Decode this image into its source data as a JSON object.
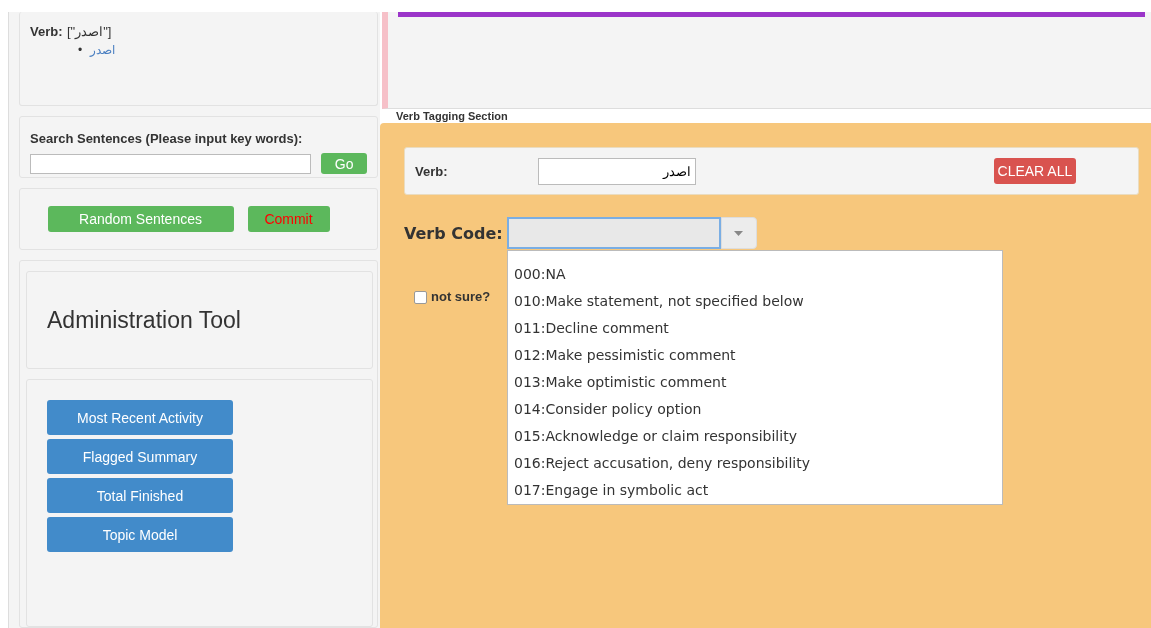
{
  "verb_panel": {
    "label": "Verb:",
    "value": "[\"اصدر\"]",
    "items": [
      {
        "bullet": "•",
        "text": "اصدر"
      }
    ]
  },
  "progress": {
    "level": 1
  },
  "search": {
    "label": "Search Sentences (Please input key words):",
    "button": "Go"
  },
  "actions": {
    "random": "Random Sentences",
    "commit": "Commit"
  },
  "admin": {
    "title": "Administration Tool",
    "buttons": [
      "Most Recent Activity",
      "Flagged Summary",
      "Total Finished",
      "Topic Model"
    ]
  },
  "tagging": {
    "section_title": "Verb Tagging Section",
    "verb_label": "Verb:",
    "verb_value": "اصدر",
    "clear_button": "CLEAR ALL",
    "code_label": "Verb Code:",
    "dropdown_open": true,
    "options": [
      "000:NA",
      "010:Make statement, not specified below",
      "011:Decline comment",
      "012:Make pessimistic comment",
      "013:Make optimistic comment",
      "014:Consider policy option",
      "015:Acknowledge or claim responsibility",
      "016:Reject accusation, deny responsibility",
      "017:Engage in symbolic act"
    ],
    "not_sure": {
      "label": "not sure?",
      "checked": false
    }
  }
}
